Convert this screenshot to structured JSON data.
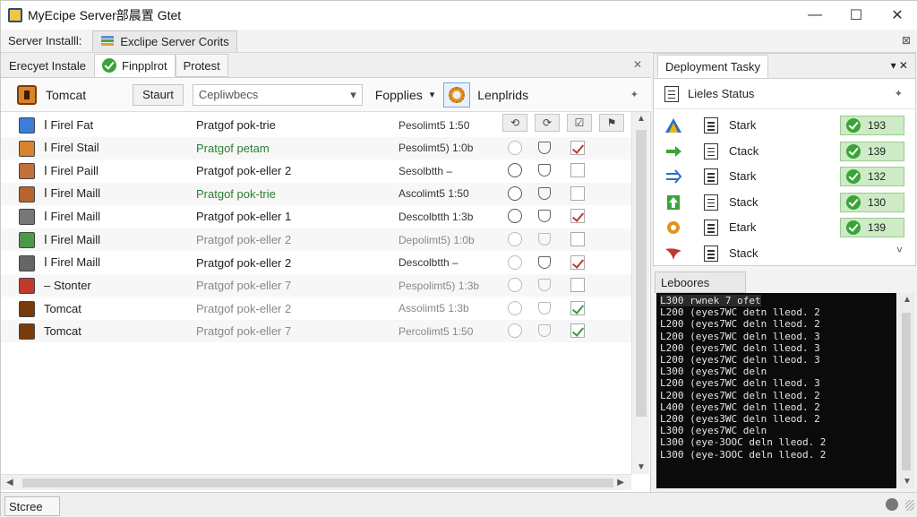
{
  "window": {
    "title": "MyEcipe Server部晨置 Gtet",
    "controls": [
      "—",
      "☐",
      "✕"
    ]
  },
  "menubar": {
    "label": "Server Installl:",
    "tab_label": "Exclipe Server Corits",
    "pin": "⊠"
  },
  "left_tabs": [
    {
      "label": "Erecyet Instale"
    },
    {
      "label": "Finpplrot"
    },
    {
      "label": "Protest"
    }
  ],
  "left_close": "✕",
  "toolbar": {
    "server_name": "Tomcat",
    "start_label": "Staurt",
    "select_value": "Cepliwbecs",
    "select_arrow": "▾",
    "properties_label": "Fopplies",
    "properties_arrow": "▾",
    "templates_label": "Lenplrids",
    "pin": "✦"
  },
  "header_buttons": [
    "⟲",
    "⟳",
    "☑",
    "⚑"
  ],
  "rows": [
    {
      "name": "Ⅰ Firel Fat",
      "desc": "Pratgof pok-trie",
      "desc_style": "",
      "time": "Pesolimt5 1:50",
      "time_style": "",
      "radio": "light",
      "shield": "",
      "check": "none",
      "icon_color": "#3b7dd8"
    },
    {
      "name": "Ⅰ Firel Stail",
      "desc": "Pratgof petam",
      "desc_style": "green",
      "time": "Pesolimt5) 1:0b",
      "time_style": "",
      "radio": "light",
      "shield": "",
      "check": "red",
      "icon_color": "#d9822b"
    },
    {
      "name": "Ⅰ Firel Paill",
      "desc": "Pratgof pok-eller 2",
      "desc_style": "",
      "time": "Sesolbtth –",
      "time_style": "",
      "radio": "",
      "shield": "",
      "check": "none",
      "icon_color": "#c46e3b"
    },
    {
      "name": "Ⅰ Firel Maill",
      "desc": "Pratgof pok-trie",
      "desc_style": "green",
      "time": "Ascolimt5 1:50",
      "time_style": "",
      "radio": "",
      "shield": "",
      "check": "none",
      "icon_color": "#b7652d"
    },
    {
      "name": "Ⅰ Firel Maill",
      "desc": "Pratgof pok-eller 1",
      "desc_style": "",
      "time": "Descolbtth 1:3b",
      "time_style": "",
      "radio": "",
      "shield": "",
      "check": "red",
      "icon_color": "#777777"
    },
    {
      "name": "Ⅰ Firel Maill",
      "desc": "Pratgof pok-eller 2",
      "desc_style": "muted",
      "time": "Depolimt5) 1:0b",
      "time_style": "muted",
      "radio": "light",
      "shield": "light",
      "check": "none",
      "icon_color": "#4a9a4a"
    },
    {
      "name": "Ⅰ Firel Maill",
      "desc": "Pratgof pok-eller 2",
      "desc_style": "",
      "time": "Descolbtth –",
      "time_style": "",
      "radio": "light",
      "shield": "",
      "check": "red",
      "icon_color": "#666666"
    },
    {
      "name": "– Stonter",
      "desc": "Pratgof pok-eller 7",
      "desc_style": "muted",
      "time": "Pespolimt5) 1:3b",
      "time_style": "muted",
      "radio": "light",
      "shield": "light",
      "check": "none",
      "icon_color": "#c0392b"
    },
    {
      "name": "Tomcat",
      "desc": "Pratgof pok-eller 2",
      "desc_style": "muted",
      "time": "Assolimt5 1:3b",
      "time_style": "muted",
      "radio": "light",
      "shield": "light",
      "check": "on",
      "icon_color": "#7a3b0a"
    },
    {
      "name": "Tomcat",
      "desc": "Pratgof pok-eller 7",
      "desc_style": "muted",
      "time": "Percolimt5 1:50",
      "time_style": "muted",
      "radio": "light",
      "shield": "light",
      "check": "on",
      "icon_color": "#7a3b0a"
    }
  ],
  "deploy": {
    "tab_label": "Deployment Tasky",
    "tab_controls": "▾ ✕",
    "header": "Lieles Status",
    "pin": "✦",
    "more": "˅",
    "rows": [
      {
        "label": "Stark",
        "value": "193",
        "icon": "triangle"
      },
      {
        "label": "Ctack",
        "value": "139",
        "icon": "arrow-right"
      },
      {
        "label": "Stark",
        "value": "132",
        "icon": "arrow-right-blue"
      },
      {
        "label": "Stack",
        "value": "130",
        "icon": "arrow-up"
      },
      {
        "label": "Etark",
        "value": "139",
        "icon": "gear"
      },
      {
        "label": "Stack",
        "value": "",
        "icon": "wing"
      }
    ]
  },
  "log": {
    "tab_label": "Leboores",
    "lines": [
      "L300 rwnek 7 ofet",
      "L200 (eyes7WC detn lleod. 2",
      "L200 (eyes7WC deln lleod. 2",
      "L200 (eyes7WC deln lleod. 3",
      "L200 (eyes7WC deln lleod. 3",
      "L200 (eyes7WC deln lleod. 3",
      "L300 (eyes7WC deln",
      "L200 (eyes7WC deln lleod. 3",
      "L200 (eyes7WC deln lleod. 2",
      "L400 (eyes7WC deln lleod. 2",
      "L200 (eyes3WC deln lleod. 2",
      "L300 (eyes7WC deln",
      "L300 (eye-3OOC deln lleod. 2",
      "L300 (eye-3OOC deln lleod. 2"
    ]
  },
  "statusbar": {
    "label": "Stcree"
  }
}
